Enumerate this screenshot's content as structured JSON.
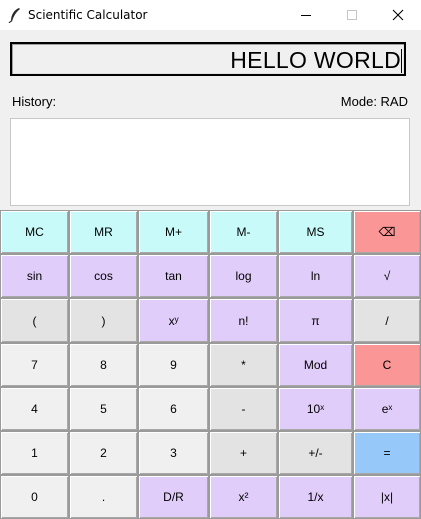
{
  "window": {
    "title": "Scientific Calculator",
    "icons": {
      "app": "feather-icon",
      "minimize": "minimize-icon",
      "maximize": "maximize-icon",
      "close": "close-icon"
    }
  },
  "display": {
    "value": "HELLO WORLD"
  },
  "history": {
    "label": "History:",
    "entries": []
  },
  "mode": {
    "label": "Mode: RAD"
  },
  "colors": {
    "memory": "#c8fafa",
    "scientific": "#e1cdfa",
    "number": "#f0f0f0",
    "operator": "#e3e3e3",
    "danger": "#fa9696",
    "equals": "#96c8fa"
  },
  "keypad": {
    "rows": [
      [
        {
          "label": "MC",
          "name": "memory-clear-button",
          "style": "memory"
        },
        {
          "label": "MR",
          "name": "memory-recall-button",
          "style": "memory"
        },
        {
          "label": "M+",
          "name": "memory-add-button",
          "style": "memory"
        },
        {
          "label": "M-",
          "name": "memory-subtract-button",
          "style": "memory"
        },
        {
          "label": "MS",
          "name": "memory-store-button",
          "style": "memory"
        },
        {
          "label": "⌫",
          "name": "backspace-button",
          "style": "danger"
        }
      ],
      [
        {
          "label": "sin",
          "name": "sin-button",
          "style": "scientific"
        },
        {
          "label": "cos",
          "name": "cos-button",
          "style": "scientific"
        },
        {
          "label": "tan",
          "name": "tan-button",
          "style": "scientific"
        },
        {
          "label": "log",
          "name": "log-button",
          "style": "scientific"
        },
        {
          "label": "ln",
          "name": "ln-button",
          "style": "scientific"
        },
        {
          "label": "√",
          "name": "sqrt-button",
          "style": "scientific"
        }
      ],
      [
        {
          "label": "(",
          "name": "open-paren-button",
          "style": "operator"
        },
        {
          "label": ")",
          "name": "close-paren-button",
          "style": "operator"
        },
        {
          "label": "xʸ",
          "name": "power-button",
          "style": "scientific"
        },
        {
          "label": "n!",
          "name": "factorial-button",
          "style": "scientific"
        },
        {
          "label": "π",
          "name": "pi-button",
          "style": "scientific"
        },
        {
          "label": "/",
          "name": "divide-button",
          "style": "operator"
        }
      ],
      [
        {
          "label": "7",
          "name": "digit-7-button",
          "style": "number"
        },
        {
          "label": "8",
          "name": "digit-8-button",
          "style": "number"
        },
        {
          "label": "9",
          "name": "digit-9-button",
          "style": "number"
        },
        {
          "label": "*",
          "name": "multiply-button",
          "style": "operator"
        },
        {
          "label": "Mod",
          "name": "mod-button",
          "style": "scientific"
        },
        {
          "label": "C",
          "name": "clear-button",
          "style": "danger"
        }
      ],
      [
        {
          "label": "4",
          "name": "digit-4-button",
          "style": "number"
        },
        {
          "label": "5",
          "name": "digit-5-button",
          "style": "number"
        },
        {
          "label": "6",
          "name": "digit-6-button",
          "style": "number"
        },
        {
          "label": "-",
          "name": "subtract-button",
          "style": "operator"
        },
        {
          "label": "10ˣ",
          "name": "ten-power-button",
          "style": "scientific"
        },
        {
          "label": "eˣ",
          "name": "exp-button",
          "style": "scientific"
        }
      ],
      [
        {
          "label": "1",
          "name": "digit-1-button",
          "style": "number"
        },
        {
          "label": "2",
          "name": "digit-2-button",
          "style": "number"
        },
        {
          "label": "3",
          "name": "digit-3-button",
          "style": "number"
        },
        {
          "label": "+",
          "name": "add-button",
          "style": "operator"
        },
        {
          "label": "+/-",
          "name": "negate-button",
          "style": "operator"
        },
        {
          "label": "=",
          "name": "equals-button",
          "style": "equals"
        }
      ],
      [
        {
          "label": "0",
          "name": "digit-0-button",
          "style": "number"
        },
        {
          "label": ".",
          "name": "decimal-button",
          "style": "number"
        },
        {
          "label": "D/R",
          "name": "deg-rad-toggle-button",
          "style": "scientific"
        },
        {
          "label": "x²",
          "name": "square-button",
          "style": "scientific"
        },
        {
          "label": "1/x",
          "name": "reciprocal-button",
          "style": "scientific"
        },
        {
          "label": "|x|",
          "name": "abs-button",
          "style": "scientific"
        }
      ]
    ]
  }
}
